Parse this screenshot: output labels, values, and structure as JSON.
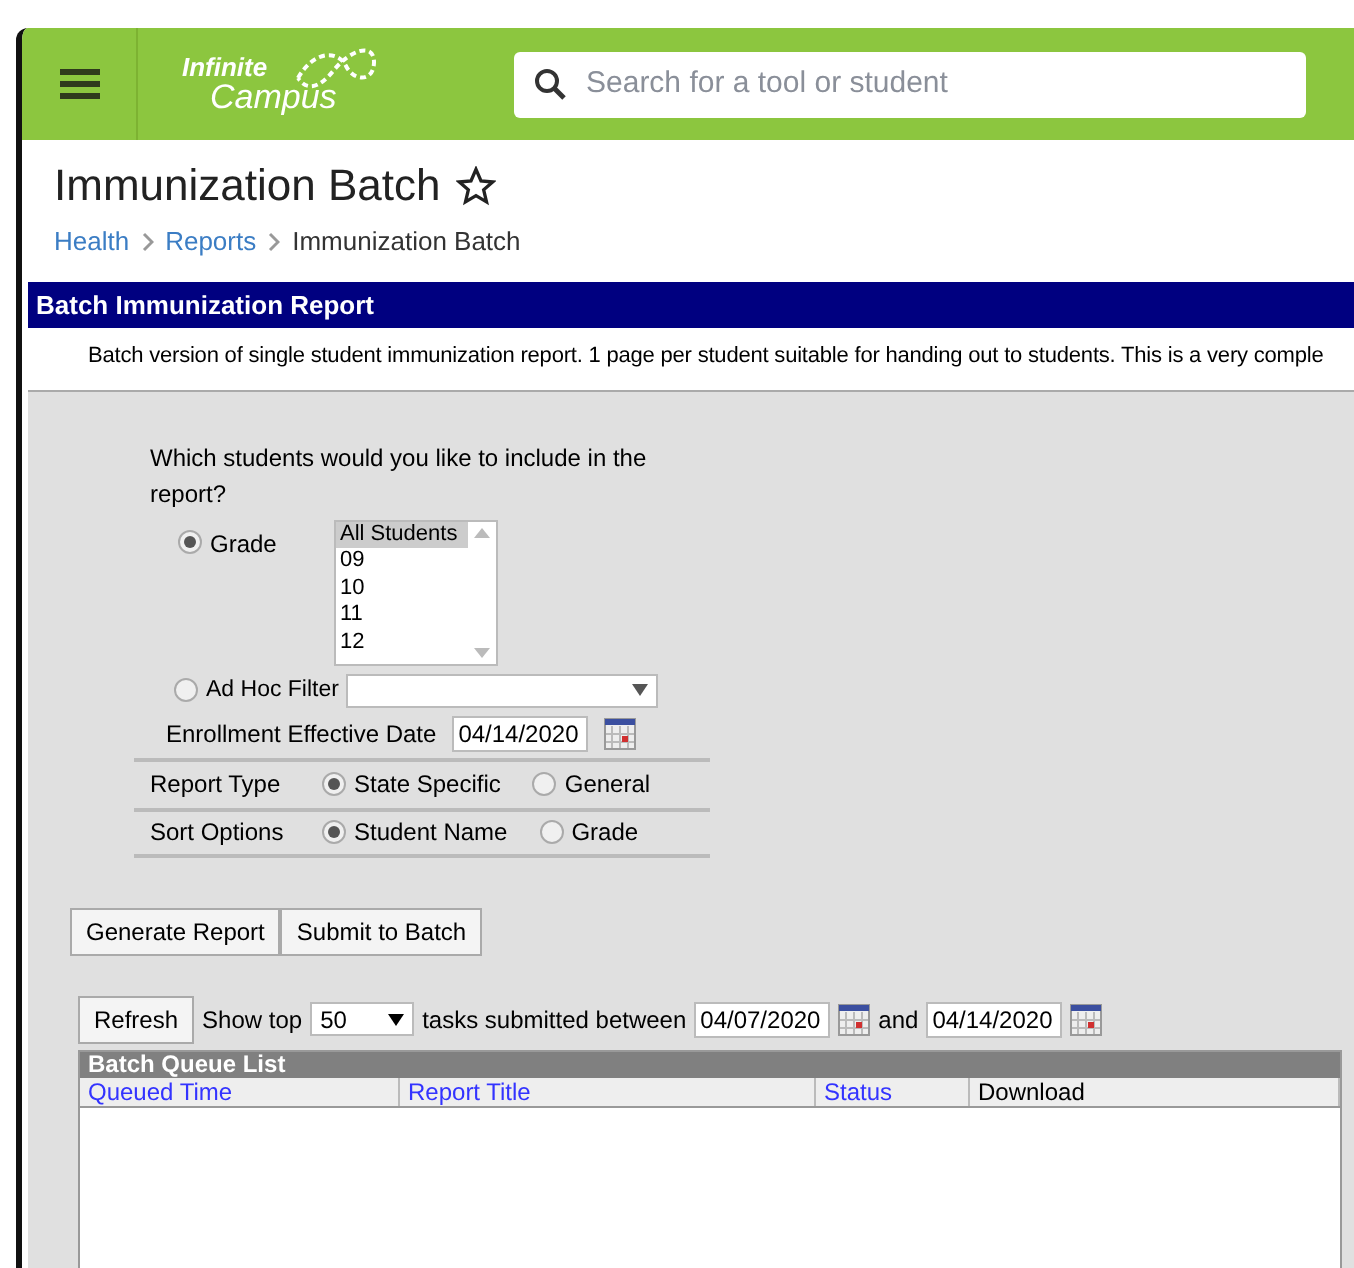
{
  "header": {
    "logo": [
      "Infinite",
      "Campus"
    ],
    "search": {
      "placeholder": "Search for a tool or student"
    }
  },
  "page": {
    "title": "Immunization Batch",
    "favorite": false,
    "breadcrumbs": [
      {
        "label": "Health",
        "link": true
      },
      {
        "label": "Reports",
        "link": true
      },
      {
        "label": "Immunization Batch",
        "link": false
      }
    ]
  },
  "report": {
    "title": "Batch Immunization Report",
    "description": "Batch version of single student immunization report. 1 page per student suitable for handing out to students. This is a very comple"
  },
  "form": {
    "question": "Which students would you like to include in the report?",
    "grade": {
      "label": "Grade",
      "selected": true,
      "options": [
        {
          "label": "All Students",
          "selected": true
        },
        {
          "label": "09",
          "selected": false
        },
        {
          "label": "10",
          "selected": false
        },
        {
          "label": "11",
          "selected": false
        },
        {
          "label": "12",
          "selected": false
        }
      ]
    },
    "ad_hoc": {
      "label": "Ad Hoc Filter",
      "selected": false
    },
    "enrollment_date": {
      "label": "Enrollment Effective Date",
      "value": "04/14/2020"
    },
    "option_rows": [
      {
        "label": "Report Type",
        "choices": [
          {
            "label": "State Specific",
            "selected": true
          },
          {
            "label": "General",
            "selected": false
          }
        ]
      },
      {
        "label": "Sort Options",
        "choices": [
          {
            "label": "Student Name",
            "selected": true
          },
          {
            "label": "Grade",
            "selected": false
          }
        ]
      }
    ],
    "buttons": [
      "Generate Report",
      "Submit to Batch"
    ]
  },
  "queue": {
    "refresh": "Refresh",
    "show_top": "Show top",
    "count": "50",
    "between": "tasks submitted between",
    "from": "04/07/2020",
    "and": "and",
    "to": "04/14/2020",
    "title": "Batch Queue List",
    "columns": [
      {
        "label": "Queued Time",
        "sortable": true
      },
      {
        "label": "Report Title",
        "sortable": true
      },
      {
        "label": "Status",
        "sortable": true
      },
      {
        "label": "Download",
        "sortable": false
      }
    ]
  }
}
